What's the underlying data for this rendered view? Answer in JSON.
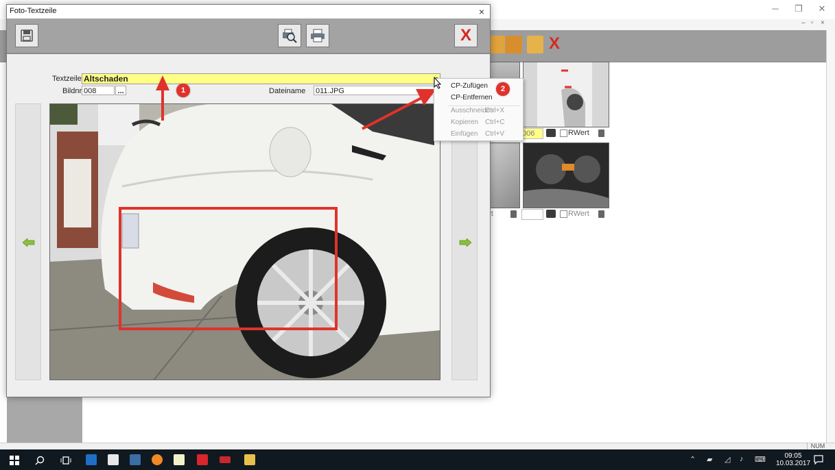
{
  "background_app": {
    "thumb_rows": [
      {
        "nr": "006",
        "rwert_label": "RWert"
      },
      {
        "nr": "",
        "partial_label": "ert",
        "rwert_label": "RWert"
      }
    ],
    "status_indicator": "NUM"
  },
  "dialog": {
    "title": "Foto-Textzeile",
    "close_glyph": "×",
    "fields": {
      "textzeile_label": "Textzeile",
      "textzeile_value": "Altschaden",
      "bildnr_label": "Bildnr",
      "bildnr_value": "008",
      "browse_label": "...",
      "dateiname_label": "Dateiname",
      "dateiname_value": "011.JPG"
    }
  },
  "context_menu": {
    "items": [
      {
        "label": "CP-Zufügen",
        "shortcut": "",
        "enabled": true
      },
      {
        "label": "CP-Entfernen",
        "shortcut": "",
        "enabled": true
      },
      {
        "label": "Ausschneiden",
        "shortcut": "Ctrl+X",
        "enabled": false
      },
      {
        "label": "Kopieren",
        "shortcut": "Ctrl+C",
        "enabled": false
      },
      {
        "label": "Einfügen",
        "shortcut": "Ctrl+V",
        "enabled": false
      }
    ]
  },
  "annotations": {
    "badge1": "1",
    "badge2": "2",
    "accent_color": "#e0322b"
  },
  "taskbar": {
    "time": "09:05",
    "date": "10.03.2017",
    "apps": [
      "start-icon",
      "search-icon",
      "task-view-icon",
      "outlook-icon",
      "explorer-icon",
      "app-icon",
      "firefox-icon",
      "notepad-icon",
      "app-red-icon",
      "app-car-icon",
      "folder-icon"
    ]
  }
}
